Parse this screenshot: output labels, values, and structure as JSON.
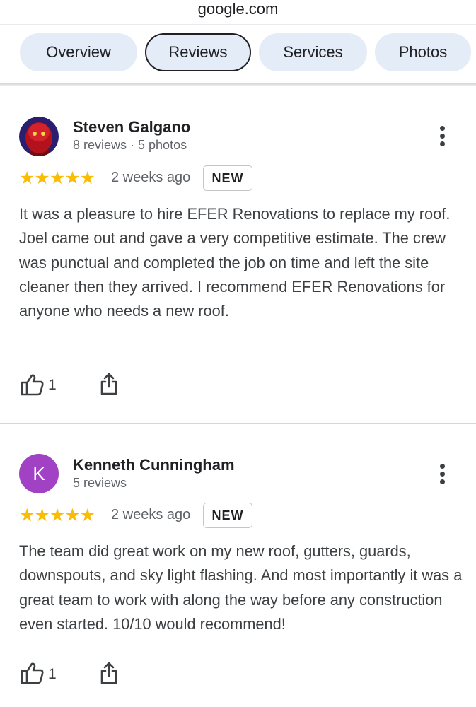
{
  "url": "google.com",
  "tabs": [
    "Overview",
    "Reviews",
    "Services",
    "Photos"
  ],
  "active_tab": "Reviews",
  "reviews": [
    {
      "name": "Steven Galgano",
      "meta": "8 reviews · 5 photos",
      "rating": 5,
      "stars": "★★★★★",
      "time": "2 weeks ago",
      "badge": "NEW",
      "text": "It was a pleasure to hire EFER Renovations to replace my roof. Joel came out and gave a very competitive estimate. The crew was punctual and completed the job on time and left the site cleaner then they arrived. I recommend EFER Renovations for anyone who needs a new roof.",
      "likes": "1"
    },
    {
      "name": "Kenneth Cunningham",
      "meta": "5 reviews",
      "avatar_letter": "K",
      "rating": 5,
      "stars": "★★★★★",
      "time": "2 weeks ago",
      "badge": "NEW",
      "text": "The team did great work on my new roof, gutters, guards, downspouts, and sky light flashing. And most importantly it was a great team to work with along the way before any construction even started. 10/10 would recommend!",
      "likes": "1"
    }
  ],
  "colors": {
    "star": "#fbbc04",
    "tab_bg": "#e3ecf7",
    "avatar_k": "#a142c4"
  }
}
